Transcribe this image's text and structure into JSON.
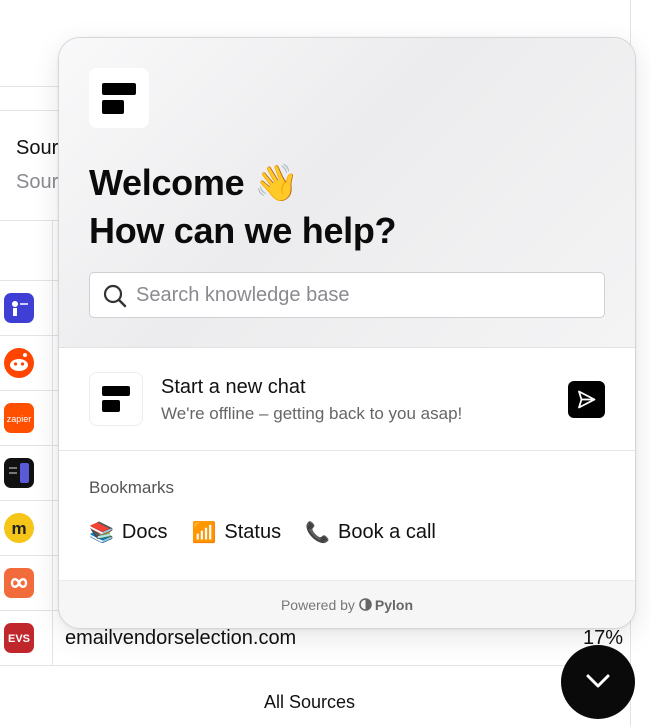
{
  "background": {
    "header_title": "Sour",
    "header_subtitle": "Sour",
    "last_row_domain": "emailvendorselection.com",
    "last_row_percent": "17%",
    "footer_link": "All Sources",
    "source_icons": [
      {
        "name": "app-icon",
        "bg": "#3f3fd6"
      },
      {
        "name": "reddit-icon",
        "bg": "#ff4500"
      },
      {
        "name": "zapier-icon",
        "bg": "#ff4f00",
        "label": "zapier"
      },
      {
        "name": "dark-app-icon",
        "bg": "#111111"
      },
      {
        "name": "m-logo-icon",
        "bg": "#f5c518",
        "label": "m"
      },
      {
        "name": "infinity-logo-icon",
        "bg": "#f26b3a"
      },
      {
        "name": "evs-logo-icon",
        "bg": "#c0272d",
        "label": "EVS"
      }
    ]
  },
  "widget": {
    "welcome": "Welcome 👋",
    "headline": "How can we help?",
    "search_placeholder": "Search knowledge base",
    "chat_title": "Start a new chat",
    "chat_subtitle": "We're offline – getting back to you asap!",
    "bookmarks_label": "Bookmarks",
    "bookmarks": [
      {
        "emoji": "📚",
        "label": "Docs"
      },
      {
        "emoji": "📶",
        "label": "Status"
      },
      {
        "emoji": "📞",
        "label": "Book a call"
      }
    ],
    "powered_by": "Powered by",
    "brand": "Pylon"
  },
  "colors": {
    "accent": "#000000",
    "fab": "#0a0a0a"
  }
}
